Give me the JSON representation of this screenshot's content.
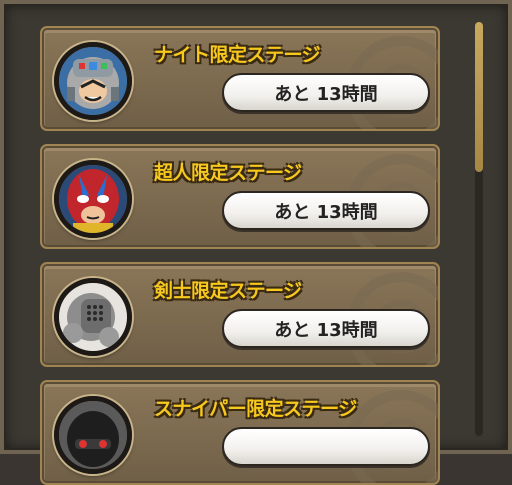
{
  "stages": [
    {
      "title": "ナイト限定ステージ",
      "time_left": "あと 13時間",
      "avatar_icon": "knight-character-icon"
    },
    {
      "title": "超人限定ステージ",
      "time_left": "あと 13時間",
      "avatar_icon": "superhuman-character-icon"
    },
    {
      "title": "剣士限定ステージ",
      "time_left": "あと 13時間",
      "avatar_icon": "swordsman-character-icon"
    },
    {
      "title": "スナイパー限定ステージ",
      "time_left": "",
      "avatar_icon": "sniper-character-icon"
    }
  ],
  "colors": {
    "title_text": "#f7c81e",
    "card_bg": "#7c6a4f",
    "frame_bg": "#3c3832",
    "scrollbar": "#c9a860"
  }
}
